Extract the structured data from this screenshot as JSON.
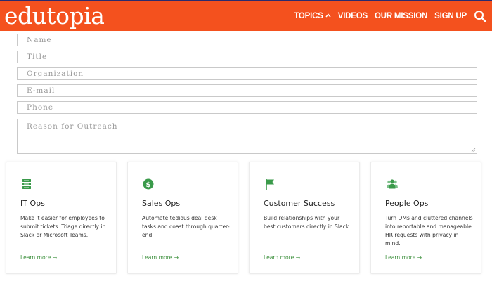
{
  "header": {
    "logo": "edutopia",
    "nav": [
      {
        "label": "TOPICS",
        "has_caret": true,
        "caret": "^"
      },
      {
        "label": "VIDEOS"
      },
      {
        "label": "OUR MISSION"
      },
      {
        "label": "SIGN UP"
      }
    ],
    "search_icon": "search-icon",
    "colors": {
      "bar": "#f4511e",
      "top_border": "#2b2b6e",
      "text": "#ffffff"
    }
  },
  "form": {
    "fields": [
      {
        "placeholder": "Name",
        "value": ""
      },
      {
        "placeholder": "Title",
        "value": ""
      },
      {
        "placeholder": "Organization",
        "value": ""
      },
      {
        "placeholder": "E-mail",
        "value": ""
      },
      {
        "placeholder": "Phone",
        "value": ""
      }
    ],
    "reason": {
      "placeholder": "Reason for Outreach",
      "value": ""
    }
  },
  "cards": [
    {
      "icon": "server-stack-icon",
      "title": "IT Ops",
      "desc": "Make it easier for employees to submit tickets. Triage directly in Slack or Microsoft Teams.",
      "link": "Learn more →"
    },
    {
      "icon": "dollar-coin-icon",
      "title": "Sales Ops",
      "desc": "Automate tedious deal desk tasks and coast through quarter-end.",
      "link": "Learn more →"
    },
    {
      "icon": "flag-icon",
      "title": "Customer Success",
      "desc": "Build relationships with your best customers directly in Slack.",
      "link": "Learn more →"
    },
    {
      "icon": "people-group-icon",
      "title": "People Ops",
      "desc": "Turn DMs and cluttered channels into reportable and manageable HR requests with privacy in mind.",
      "link": "Learn more →"
    }
  ],
  "colors": {
    "accent_green": "#3a8f3a",
    "field_border": "#c9c9c9"
  }
}
